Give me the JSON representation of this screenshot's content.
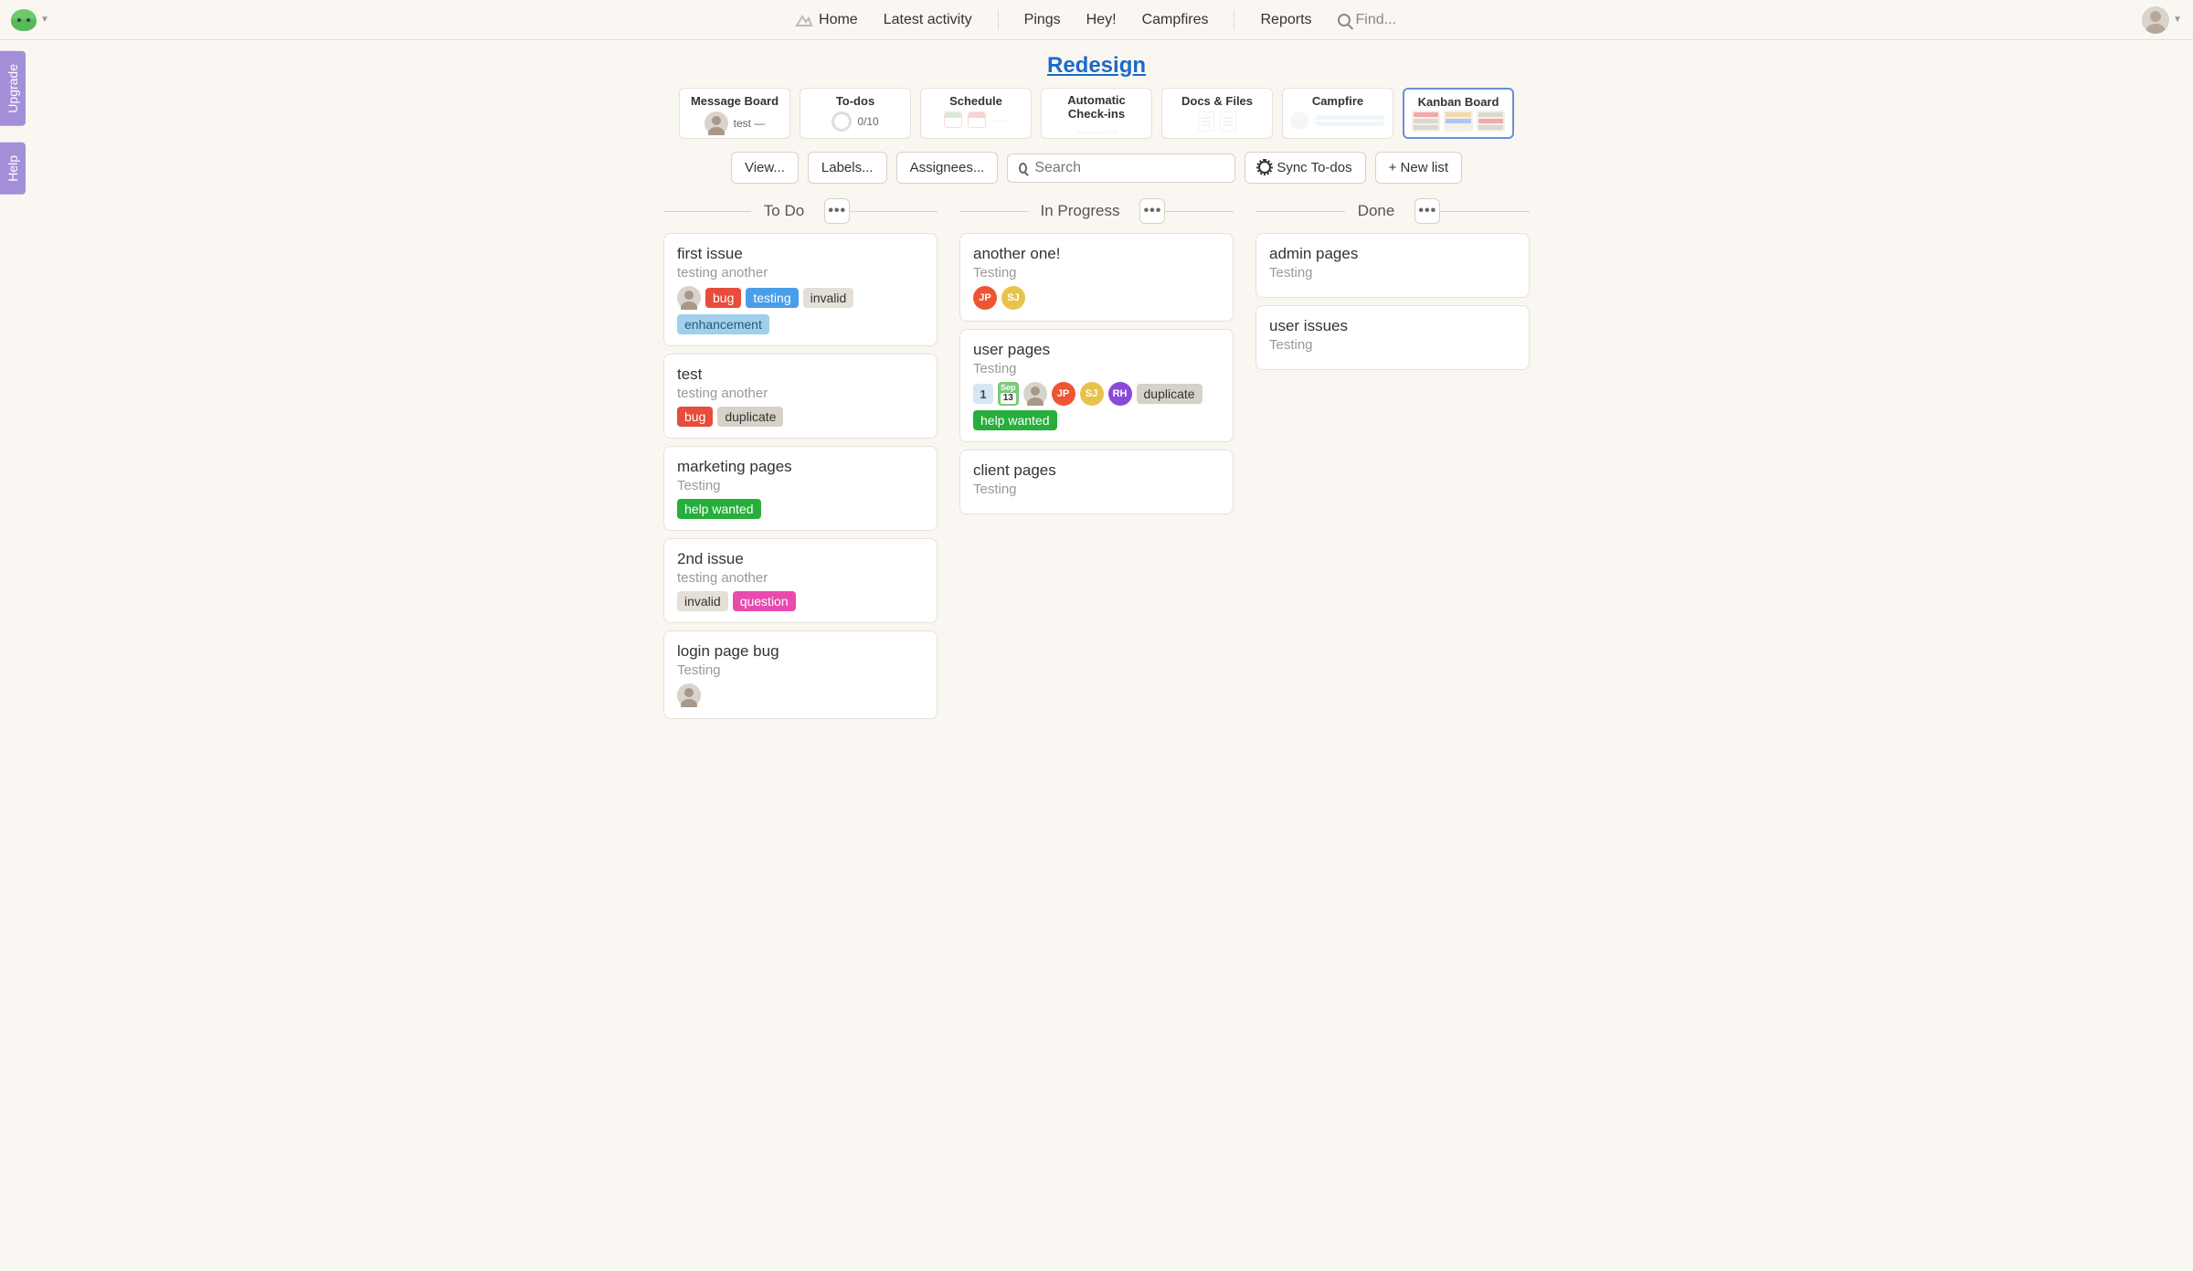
{
  "nav": {
    "home": "Home",
    "latest": "Latest activity",
    "pings": "Pings",
    "hey": "Hey!",
    "campfires": "Campfires",
    "reports": "Reports",
    "find": "Find..."
  },
  "side": {
    "upgrade": "Upgrade",
    "help": "Help"
  },
  "project": {
    "title": "Redesign"
  },
  "tools": [
    {
      "name": "Message Board",
      "subtext": "test —"
    },
    {
      "name": "To-dos",
      "subtext": "0/10"
    },
    {
      "name": "Schedule",
      "subtext": ""
    },
    {
      "name": "Automatic Check-ins",
      "subtext": ""
    },
    {
      "name": "Docs & Files",
      "subtext": ""
    },
    {
      "name": "Campfire",
      "subtext": ""
    },
    {
      "name": "Kanban Board",
      "subtext": ""
    }
  ],
  "toolbar": {
    "view": "View...",
    "labels": "Labels...",
    "assignees": "Assignees...",
    "search_placeholder": "Search",
    "sync": "Sync To-dos",
    "newlist": "+ New list"
  },
  "columns": [
    {
      "title": "To Do",
      "cards": [
        {
          "title": "first issue",
          "sub": "testing another",
          "avatars": [
            {
              "type": "photo"
            }
          ],
          "labels": [
            {
              "text": "bug",
              "cls": "bug"
            },
            {
              "text": "testing",
              "cls": "testing"
            },
            {
              "text": "invalid",
              "cls": "invalid"
            },
            {
              "text": "enhancement",
              "cls": "enhancement"
            }
          ]
        },
        {
          "title": "test",
          "sub": "testing another",
          "avatars": [],
          "labels": [
            {
              "text": "bug",
              "cls": "bug"
            },
            {
              "text": "duplicate",
              "cls": "duplicate"
            }
          ]
        },
        {
          "title": "marketing pages",
          "sub": "Testing",
          "avatars": [],
          "labels": [
            {
              "text": "help wanted",
              "cls": "helpwanted"
            }
          ]
        },
        {
          "title": "2nd issue",
          "sub": "testing another",
          "avatars": [],
          "labels": [
            {
              "text": "invalid",
              "cls": "invalid"
            },
            {
              "text": "question",
              "cls": "question"
            }
          ]
        },
        {
          "title": "login page bug",
          "sub": "Testing",
          "avatars": [
            {
              "type": "photo"
            }
          ],
          "labels": []
        }
      ]
    },
    {
      "title": "In Progress",
      "cards": [
        {
          "title": "another one!",
          "sub": "Testing",
          "avatars": [
            {
              "type": "jp",
              "text": "JP"
            },
            {
              "type": "sj",
              "text": "SJ"
            }
          ],
          "labels": []
        },
        {
          "title": "user pages",
          "sub": "Testing",
          "count": "1",
          "date": {
            "mon": "Sep",
            "day": "13"
          },
          "avatars": [
            {
              "type": "photo"
            },
            {
              "type": "jp",
              "text": "JP"
            },
            {
              "type": "sj",
              "text": "SJ"
            },
            {
              "type": "rh",
              "text": "RH"
            }
          ],
          "labels": [
            {
              "text": "duplicate",
              "cls": "duplicate"
            },
            {
              "text": "help wanted",
              "cls": "helpwanted"
            }
          ]
        },
        {
          "title": "client pages",
          "sub": "Testing",
          "avatars": [],
          "labels": []
        }
      ]
    },
    {
      "title": "Done",
      "cards": [
        {
          "title": "admin pages",
          "sub": "Testing",
          "avatars": [],
          "labels": []
        },
        {
          "title": "user issues",
          "sub": "Testing",
          "avatars": [],
          "labels": []
        }
      ]
    }
  ]
}
